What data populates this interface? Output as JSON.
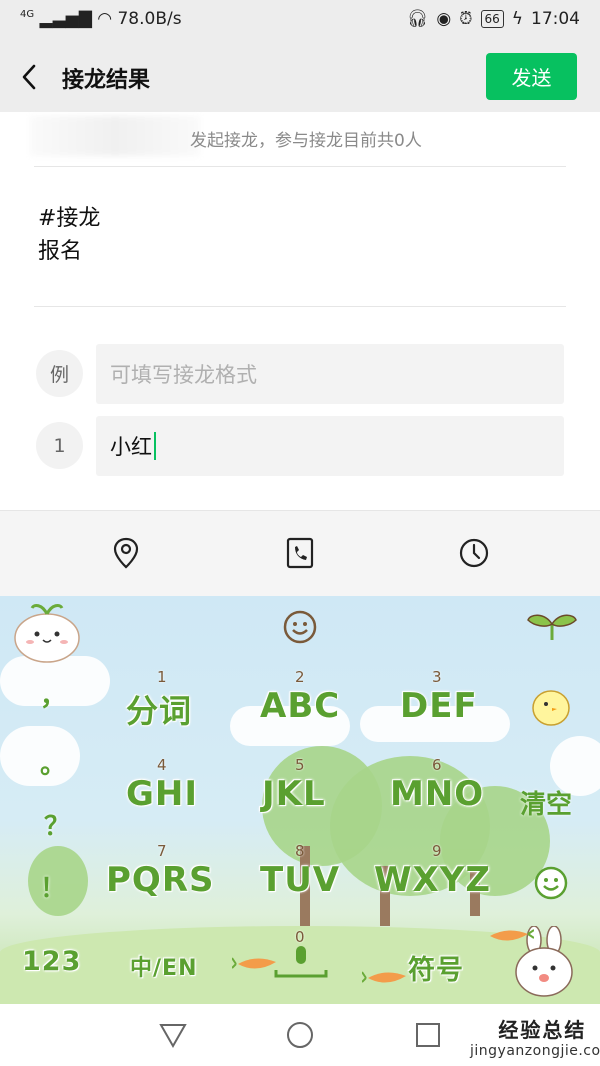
{
  "status_bar": {
    "network": "4G",
    "speed": "78.0B/s",
    "battery": "66",
    "time": "17:04"
  },
  "header": {
    "title": "接龙结果",
    "send_label": "发送"
  },
  "info_text": "发起接龙，参与接龙目前共0人",
  "topic": {
    "line1": "#接龙",
    "line2": "报名"
  },
  "entries": [
    {
      "index": "例",
      "placeholder": "可填写接龙格式",
      "value": ""
    },
    {
      "index": "1",
      "placeholder": "",
      "value": "小红"
    }
  ],
  "toolbar": {
    "icons": [
      "location-icon",
      "phone-icon",
      "clock-icon"
    ]
  },
  "keyboard": {
    "rows": [
      [
        {
          "digit": "1",
          "label": "分词"
        },
        {
          "digit": "2",
          "label": "ABC"
        },
        {
          "digit": "3",
          "label": "DEF"
        }
      ],
      [
        {
          "digit": "4",
          "label": "GHI"
        },
        {
          "digit": "5",
          "label": "JKL"
        },
        {
          "digit": "6",
          "label": "MNO"
        }
      ],
      [
        {
          "digit": "7",
          "label": "PQRS"
        },
        {
          "digit": "8",
          "label": "TUV"
        },
        {
          "digit": "9",
          "label": "WXYZ"
        }
      ]
    ],
    "punct": [
      "，",
      "。",
      "？",
      "！"
    ],
    "clear_label": "清空",
    "num_label": "123",
    "lang_label": "中/EN",
    "space_digit": "0",
    "symbol_label": "符号"
  },
  "watermark": {
    "title": "经验总结",
    "url": "jingyanzongjie.com"
  },
  "colors": {
    "accent": "#07c160",
    "key_text": "#5aa030"
  }
}
